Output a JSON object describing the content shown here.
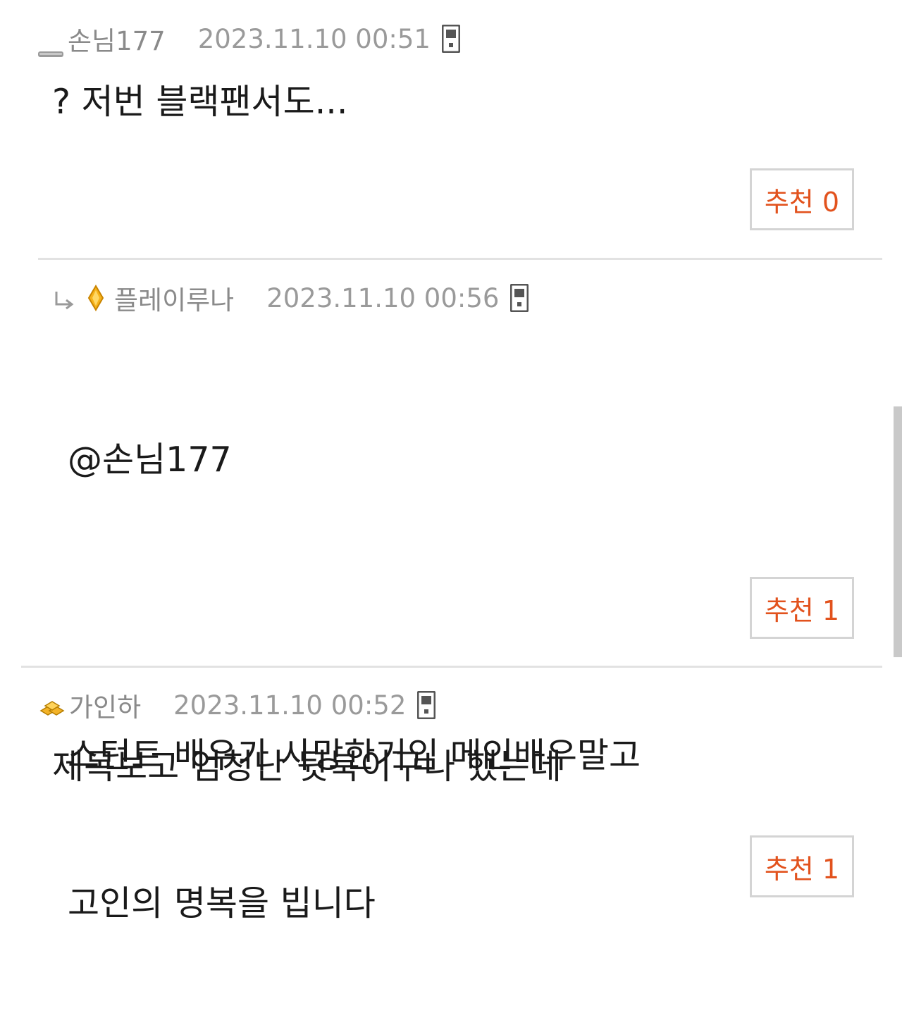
{
  "comments": [
    {
      "user": "손님177",
      "date": "2023.11.10 00:51",
      "level_icon": "guest-level-icon",
      "device_icon": "mobile-icon",
      "body": "? 저번 블랙팬서도...",
      "recommend_label": "추천 0"
    },
    {
      "reply_icon": "reply-arrow-icon",
      "user": "플레이루나",
      "date": "2023.11.10 00:56",
      "level_icon": "gold-diamond-level-icon",
      "device_icon": "mobile-icon",
      "body_lines": [
        "@손님177",
        "",
        "스턴트 배우가 사망한거임 메인배우말고",
        "고인의 명복을 빕니다"
      ],
      "recommend_label": "추천 1"
    },
    {
      "user": "가인하",
      "date": "2023.11.10 00:52",
      "level_icon": "gold-bars-level-icon",
      "device_icon": "mobile-icon",
      "body": "제목보고 엄청난 뒷북이구나 했는데",
      "recommend_label": "추천 1"
    }
  ],
  "colors": {
    "recommend_text": "#e2521d",
    "meta_text": "#8a8a8a",
    "divider": "#e2e2e2"
  }
}
